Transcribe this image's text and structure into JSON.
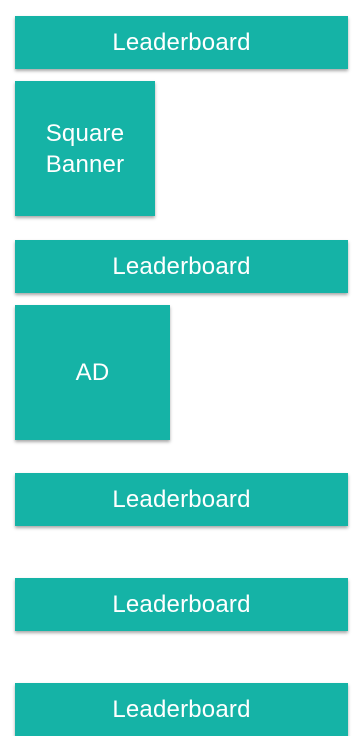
{
  "theme": {
    "accent": "#15b3a6",
    "text": "#ffffff",
    "background": "#ffffff"
  },
  "ads": {
    "leaderboard_1": "Leaderboard",
    "square_banner": "Square Banner",
    "leaderboard_2": "Leaderboard",
    "ad_box": "AD",
    "leaderboard_3": "Leaderboard",
    "leaderboard_4": "Leaderboard",
    "leaderboard_5": "Leaderboard"
  }
}
